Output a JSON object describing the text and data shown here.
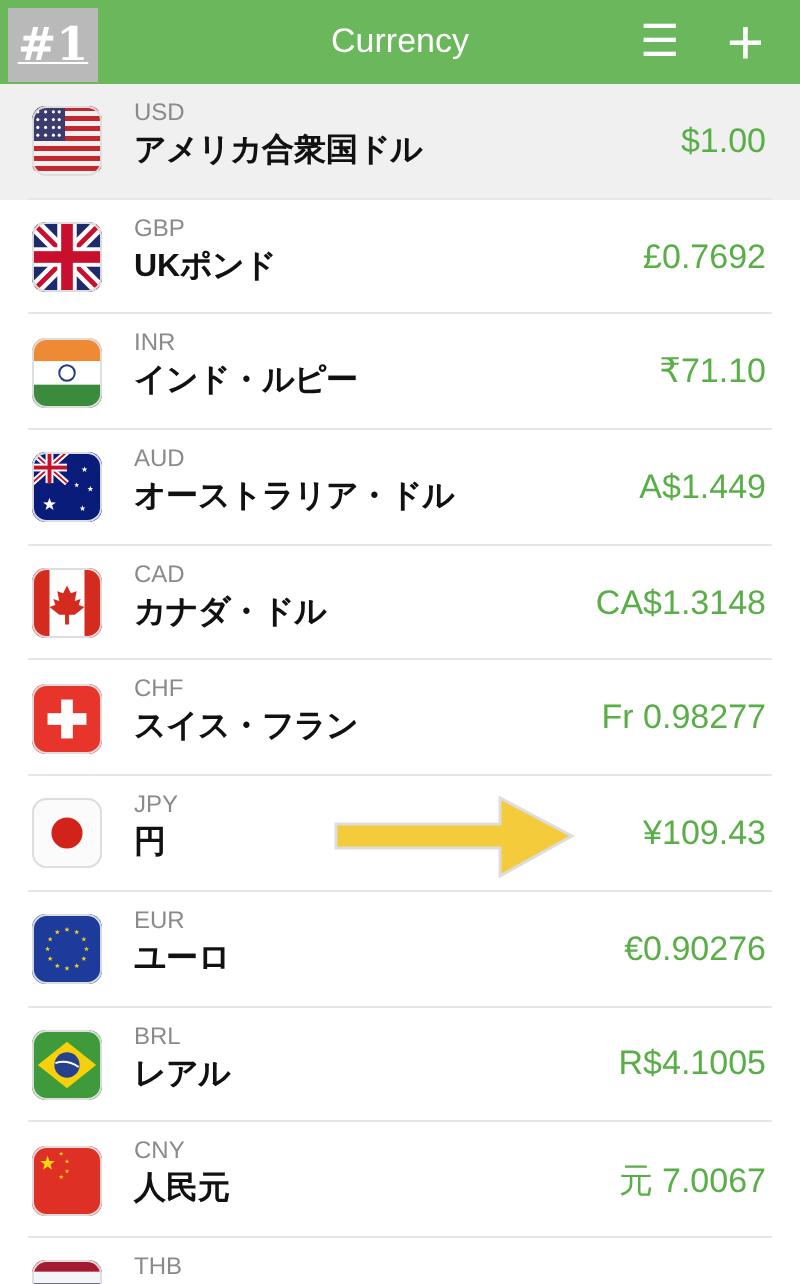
{
  "badge": "#1",
  "header": {
    "title": "Currency",
    "menu_icon": "☰",
    "add_icon": "+"
  },
  "currencies": [
    {
      "code": "USD",
      "name": "アメリカ合衆国ドル",
      "value": "$1.00",
      "selected": true
    },
    {
      "code": "GBP",
      "name": "UKポンド",
      "value": "£0.7692",
      "selected": false
    },
    {
      "code": "INR",
      "name": "インド・ルピー",
      "value": "₹71.10",
      "selected": false
    },
    {
      "code": "AUD",
      "name": "オーストラリア・ドル",
      "value": "A$1.449",
      "selected": false
    },
    {
      "code": "CAD",
      "name": "カナダ・ドル",
      "value": "CA$1.3148",
      "selected": false
    },
    {
      "code": "CHF",
      "name": "スイス・フラン",
      "value": "Fr 0.98277",
      "selected": false
    },
    {
      "code": "JPY",
      "name": "円",
      "value": "¥109.43",
      "selected": false
    },
    {
      "code": "EUR",
      "name": "ユーロ",
      "value": "€0.90276",
      "selected": false
    },
    {
      "code": "BRL",
      "name": "レアル",
      "value": "R$4.1005",
      "selected": false
    },
    {
      "code": "CNY",
      "name": "人民元",
      "value": "元 7.0067",
      "selected": false
    },
    {
      "code": "THB",
      "selected": false
    }
  ]
}
